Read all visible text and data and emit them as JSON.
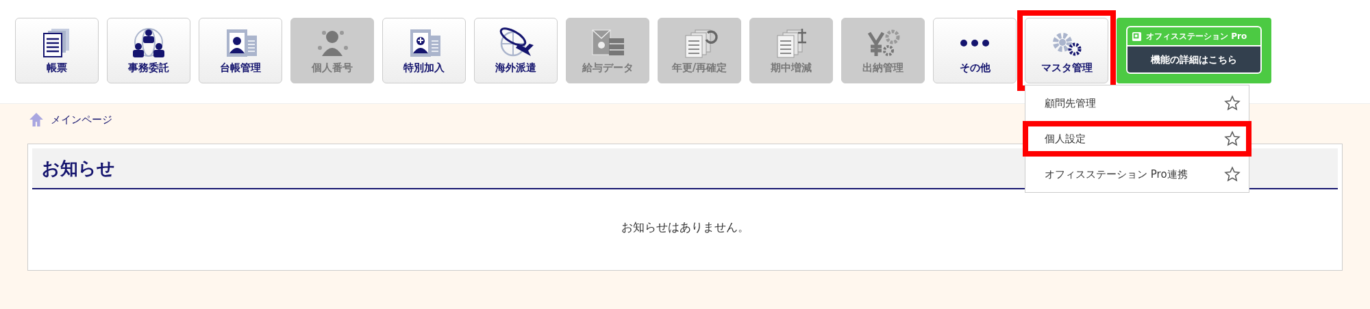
{
  "toolbar": [
    {
      "kind": "button",
      "label": "帳票",
      "disabled": false,
      "highlighted": false
    },
    {
      "kind": "button",
      "label": "事務委託",
      "disabled": false,
      "highlighted": false
    },
    {
      "kind": "button",
      "label": "台帳管理",
      "disabled": false,
      "highlighted": false
    },
    {
      "kind": "button",
      "label": "個人番号",
      "disabled": true,
      "highlighted": false
    },
    {
      "kind": "button",
      "label": "特別加入",
      "disabled": false,
      "highlighted": false
    },
    {
      "kind": "button",
      "label": "海外派遣",
      "disabled": false,
      "highlighted": false
    },
    {
      "kind": "button",
      "label": "給与データ",
      "disabled": true,
      "highlighted": false
    },
    {
      "kind": "button",
      "label": "年更/再確定",
      "disabled": true,
      "highlighted": false
    },
    {
      "kind": "button",
      "label": "期中増減",
      "disabled": true,
      "highlighted": false
    },
    {
      "kind": "button",
      "label": "出納管理",
      "disabled": true,
      "highlighted": false
    },
    {
      "kind": "button",
      "label": "その他",
      "disabled": false,
      "highlighted": false
    },
    {
      "kind": "button",
      "label": "マスタ管理",
      "disabled": false,
      "highlighted": true,
      "expanded": true
    },
    {
      "kind": "promo",
      "label": "オフィスステーション Pro",
      "action": "機能の詳細はこちら"
    }
  ],
  "dropdown": [
    {
      "label": "顧問先管理",
      "highlighted": false
    },
    {
      "label": "個人設定",
      "highlighted": true
    },
    {
      "label": "オフィスステーション Pro連携",
      "highlighted": false
    }
  ],
  "breadcrumb": "メインページ",
  "notice": {
    "title": "お知らせ",
    "message": "お知らせはありません。"
  }
}
